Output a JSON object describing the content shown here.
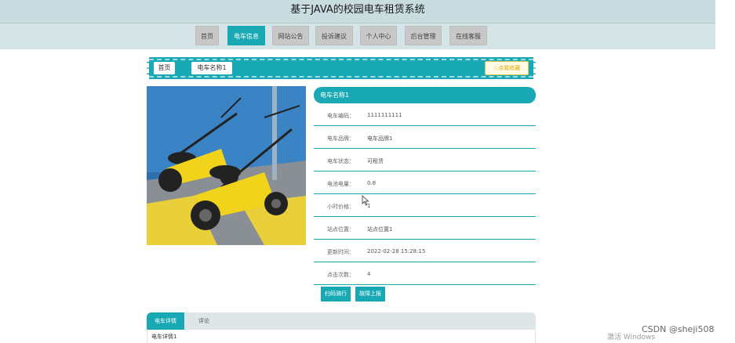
{
  "header": {
    "title": "基于JAVA的校园电车租赁系统"
  },
  "nav": {
    "items": [
      {
        "label": "首页",
        "active": false
      },
      {
        "label": "电车信息",
        "active": true
      },
      {
        "label": "网站公告",
        "active": false
      },
      {
        "label": "投诉建议",
        "active": false
      },
      {
        "label": "个人中心",
        "active": false
      },
      {
        "label": "后台管理",
        "active": false
      },
      {
        "label": "在线客服",
        "active": false
      }
    ]
  },
  "breadcrumb": {
    "home": "首页",
    "current": "电车名称1"
  },
  "favorite": {
    "label": "☆点我收藏"
  },
  "info": {
    "title": "电车名称1",
    "rows": [
      {
        "label": "电车编码：",
        "value": "1111111111"
      },
      {
        "label": "电车品牌：",
        "value": "电车品牌1"
      },
      {
        "label": "电车状态：",
        "value": "可租赁"
      },
      {
        "label": "电池电量：",
        "value": "0.8"
      },
      {
        "label": "小时价格：",
        "value": "1"
      },
      {
        "label": "站点位置：",
        "value": "站点位置1"
      },
      {
        "label": "更新时间：",
        "value": "2022-02-28 15:28:15"
      },
      {
        "label": "点击次数：",
        "value": "4"
      }
    ]
  },
  "actions": {
    "scan": "扫码骑行",
    "report": "故障上报"
  },
  "tabs": [
    {
      "label": "电车详情",
      "active": true
    },
    {
      "label": "评论",
      "active": false
    }
  ],
  "detail": {
    "text": "电车详情1"
  },
  "overlay": {
    "windows": "激活 Windows",
    "csdn": "CSDN @sheji508"
  },
  "colors": {
    "accent": "#18a9b4",
    "nav_bg": "#d5e4e7"
  }
}
